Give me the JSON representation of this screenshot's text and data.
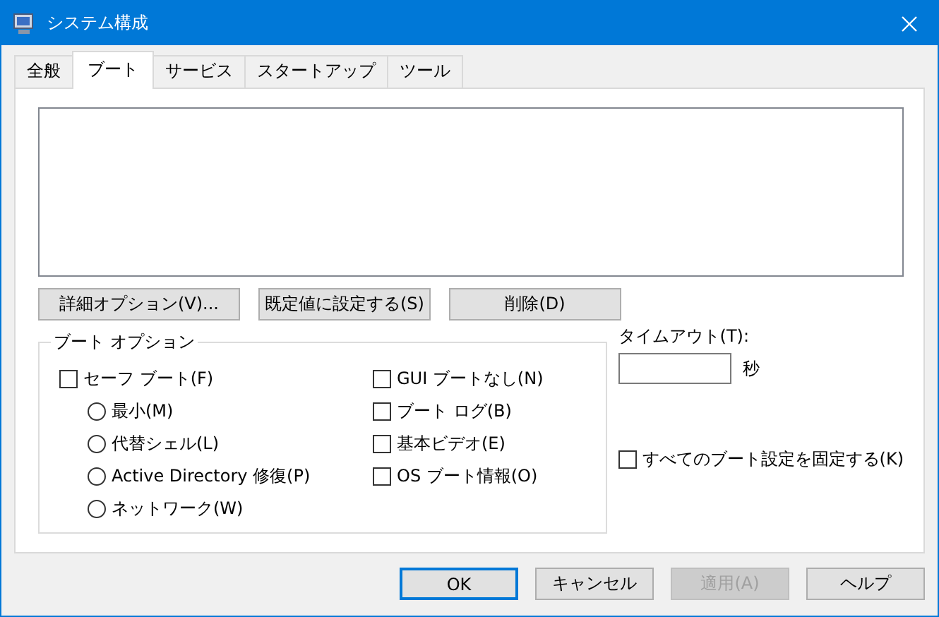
{
  "window": {
    "title": "システム構成"
  },
  "tabs": [
    {
      "label": "全般",
      "selected": false
    },
    {
      "label": "ブート",
      "selected": true
    },
    {
      "label": "サービス",
      "selected": false
    },
    {
      "label": "スタートアップ",
      "selected": false
    },
    {
      "label": "ツール",
      "selected": false
    }
  ],
  "boot_buttons": [
    {
      "label": "詳細オプション(V)..."
    },
    {
      "label": "既定値に設定する(S)"
    },
    {
      "label": "削除(D)"
    }
  ],
  "boot_options": {
    "title": "ブート オプション",
    "left": [
      {
        "label": "セーフ ブート(F)",
        "checked": false,
        "children": [
          {
            "label": "最小(M)",
            "selected": false
          },
          {
            "label": "代替シェル(L)",
            "selected": false
          },
          {
            "label": "Active Directory 修復(P)",
            "selected": false
          },
          {
            "label": "ネットワーク(W)",
            "selected": false
          }
        ]
      }
    ],
    "right": [
      {
        "label": "GUI ブートなし(N)",
        "checked": false
      },
      {
        "label": "ブート ログ(B)",
        "checked": false
      },
      {
        "label": "基本ビデオ(E)",
        "checked": false
      },
      {
        "label": "OS ブート情報(O)",
        "checked": false
      }
    ]
  },
  "timeout": {
    "label": "タイムアウト(T):",
    "unit": "秒"
  },
  "lock": {
    "label": "すべてのブート設定を固定する(K)",
    "checked": false
  },
  "footer_buttons": [
    {
      "label": "OK",
      "focused": true,
      "disabled": false
    },
    {
      "label": "キャンセル",
      "focused": false,
      "disabled": false
    },
    {
      "label": "適用(A)",
      "focused": false,
      "disabled": true
    },
    {
      "label": "ヘルプ",
      "focused": false,
      "disabled": false
    }
  ]
}
